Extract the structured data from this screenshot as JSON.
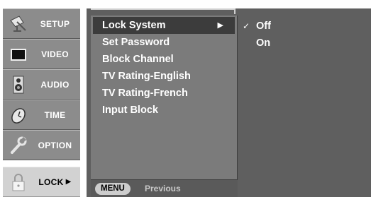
{
  "tabs": [
    {
      "label": "SETUP",
      "icon": "satellite-dish-icon"
    },
    {
      "label": "VIDEO",
      "icon": "screen-icon"
    },
    {
      "label": "AUDIO",
      "icon": "speaker-icon"
    },
    {
      "label": "TIME",
      "icon": "clock-icon"
    },
    {
      "label": "OPTION",
      "icon": "wrench-icon"
    },
    {
      "label": "LOCK",
      "icon": "padlock-icon",
      "arrow": "▶",
      "active": true
    }
  ],
  "menu": {
    "items": [
      "Lock System",
      "Set Password",
      "Block Channel",
      "TV Rating-English",
      "TV Rating-French",
      "Input Block"
    ],
    "selected_index": 0,
    "submenu_marker": "▶"
  },
  "options": {
    "items": [
      "Off",
      "On"
    ],
    "checked_index": 0,
    "check_mark": "✓"
  },
  "bottom": {
    "menu_button": "MENU",
    "action": "Previous"
  },
  "colors": {
    "tab_bg": "#8c8c8c",
    "tab_active_bg": "#d2d2d2",
    "panel_bg": "#5f5f5f",
    "menu_bg": "#7b7b7b",
    "selected_bg": "#3c3c3c",
    "text": "#ffffff"
  }
}
